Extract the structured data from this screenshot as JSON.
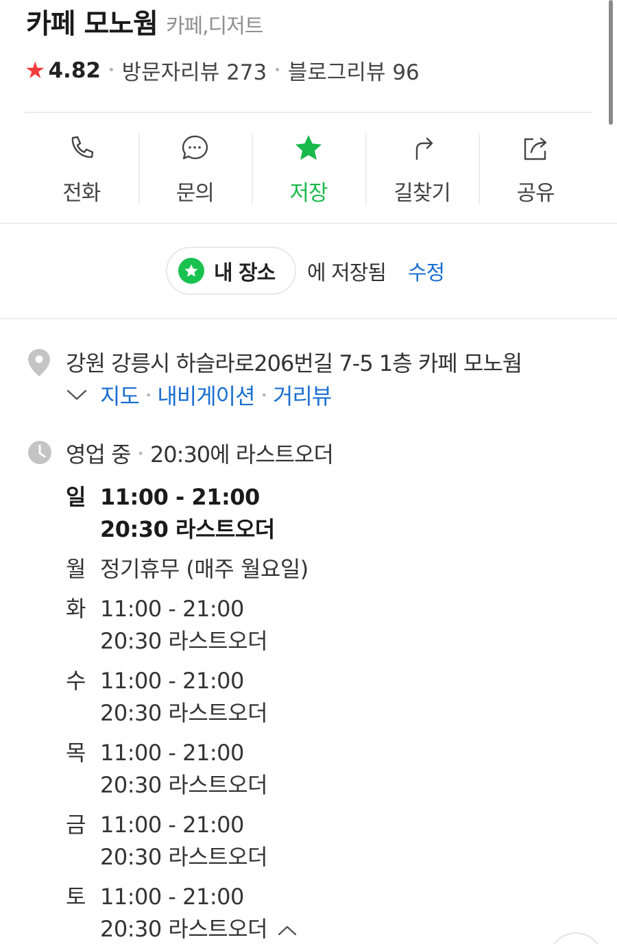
{
  "place": {
    "name": "카페 모노웜",
    "category": "카페,디저트",
    "rating": "4.82",
    "visitor_reviews": "방문자리뷰 273",
    "blog_reviews": "블로그리뷰 96"
  },
  "actions": [
    {
      "label": "전화",
      "icon": "phone-icon"
    },
    {
      "label": "문의",
      "icon": "chat-icon"
    },
    {
      "label": "저장",
      "icon": "star-icon",
      "active": true
    },
    {
      "label": "길찾기",
      "icon": "directions-icon"
    },
    {
      "label": "공유",
      "icon": "share-icon"
    }
  ],
  "saved": {
    "list_name": "내 장소",
    "saved_text": "에 저장됨",
    "edit_label": "수정"
  },
  "address": {
    "text": "강원 강릉시 하슬라로206번길 7-5 1층 카페 모노웜",
    "links": [
      "지도",
      "내비게이션",
      "거리뷰"
    ]
  },
  "hours": {
    "status": "영업 중",
    "last_order_summary": "20:30에 라스트오더",
    "days": [
      {
        "day": "일",
        "time": "11:00 - 21:00",
        "last_order": "20:30 라스트오더"
      },
      {
        "day": "월",
        "time": "정기휴무 (매주 월요일)",
        "last_order": ""
      },
      {
        "day": "화",
        "time": "11:00 - 21:00",
        "last_order": "20:30 라스트오더"
      },
      {
        "day": "수",
        "time": "11:00 - 21:00",
        "last_order": "20:30 라스트오더"
      },
      {
        "day": "목",
        "time": "11:00 - 21:00",
        "last_order": "20:30 라스트오더"
      },
      {
        "day": "금",
        "time": "11:00 - 21:00",
        "last_order": "20:30 라스트오더"
      },
      {
        "day": "토",
        "time": "11:00 - 21:00",
        "last_order": "20:30 라스트오더"
      }
    ]
  },
  "colors": {
    "accent_green": "#19c24f",
    "link_blue": "#1a6fd0",
    "rating_star": "#f23b3b"
  }
}
